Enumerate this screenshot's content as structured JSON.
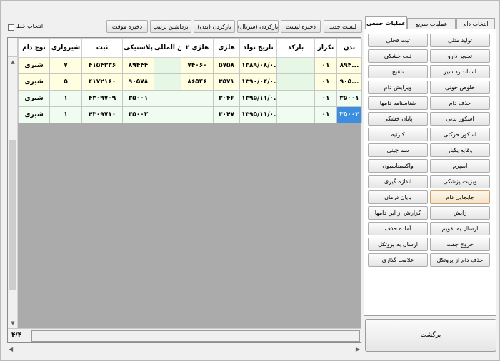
{
  "toolbar": {
    "select_line_label": "انتخاب خط",
    "buttons": [
      "لیست جدید",
      "ذخیره لیست",
      "بازکردن (سریال)",
      "بازکردن (بدن)",
      "برداشتن ترتیب",
      "ذخیره موقت"
    ]
  },
  "grid": {
    "columns": [
      "بدن",
      "تکرار",
      "بارکد",
      "تاریخ تولد",
      "هلژی",
      "هلژی ۲",
      "بین المللی",
      "پلاستیکی",
      "ثبت",
      "شیرواری",
      "نوع دام"
    ],
    "rows": [
      [
        "۸۹۴...",
        "۰۱",
        "",
        "۱۳۸۹/۰۸/۰...",
        "۵۷۵۸",
        "۷۴۰۶۰",
        "",
        "۸۹۴۴۴",
        "۴۱۵۴۳۳۶",
        "۷",
        "شیری"
      ],
      [
        "۹۰۵...",
        "۰۱",
        "",
        "۱۳۹۰/۰۴/۰...",
        "۳۵۷۱",
        "۸۶۵۴۶",
        "",
        "۹۰۵۷۸",
        "۴۱۷۲۱۶۰",
        "۵",
        "شیری"
      ],
      [
        "۳۵۰۰۱",
        "۰۱",
        "",
        "۱۳۹۵/۱۱/۰...",
        "۳۰۴۶",
        "",
        "",
        "۳۵۰۰۱",
        "۴۳۰۹۷۰۹",
        "۱",
        "شیری"
      ],
      [
        "۳۵۰۰۲",
        "۰۱",
        "",
        "۱۳۹۵/۱۱/۰...",
        "۳۰۴۷",
        "",
        "",
        "۳۵۰۰۲",
        "۴۳۰۹۷۱۰",
        "۱",
        "شیری"
      ]
    ],
    "record_count": "۴/۴"
  },
  "tabs": [
    "انتخاب دام",
    "عملیات سریع",
    "عملیات جمعی"
  ],
  "active_tab": "عملیات جمعی",
  "panel_buttons_right": [
    "تولید مثلی",
    "تجویز دارو",
    "استاندارد شیر",
    "خلوص خونی",
    "حذف دام",
    "اسکور بدنی",
    "اسکور حرکتی",
    "وقایع یکبار",
    "اسپرم",
    "ویزیت پزشکی",
    "جابجایی دام",
    "زایش",
    "ارسال به تقویم",
    "خروج جفت",
    "حذف دام از پروتکل"
  ],
  "panel_buttons_left": [
    "ثبت فحلی",
    "ثبت خشکی",
    "تلقیح",
    "ویرایش دام",
    "شناسنامه دامها",
    "پایان خشکی",
    "کارتیه",
    "سم چینی",
    "واکسیناسیون",
    "اندازه گیری",
    "پایان درمان",
    "گزارش از این دامها",
    "آماده حذف",
    "ارسال به پروتکل",
    "علامت گذاری"
  ],
  "back_label": "برگشت"
}
